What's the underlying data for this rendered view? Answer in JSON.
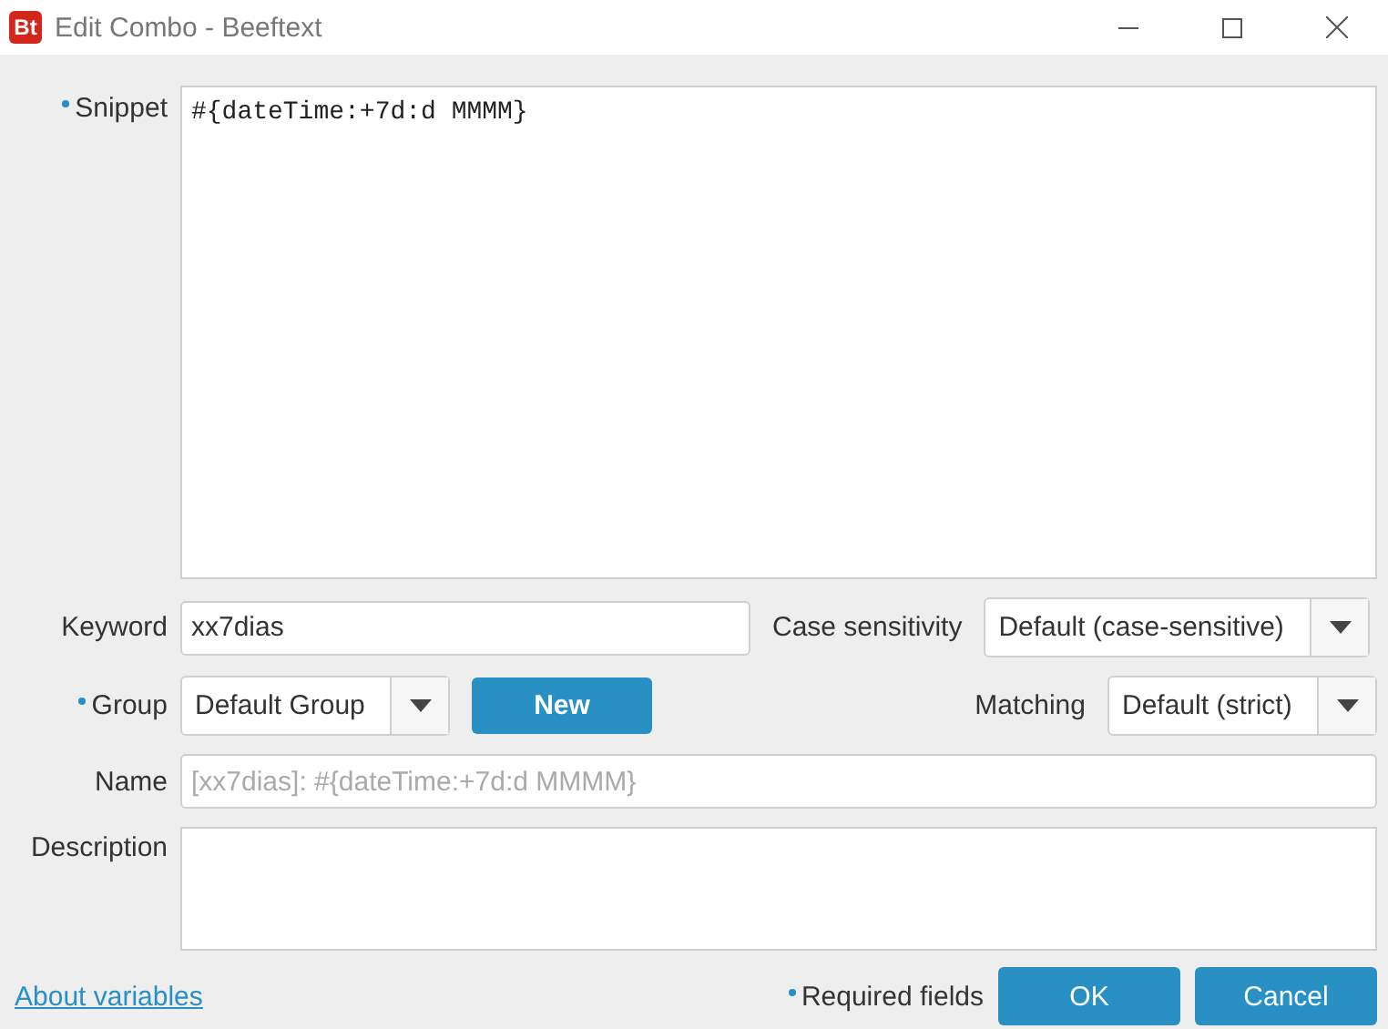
{
  "window": {
    "app_icon": "Bt",
    "title": "Edit Combo - Beeftext"
  },
  "snippet": {
    "label": "Snippet",
    "required": true,
    "value": "#{dateTime:+7d:d MMMM}"
  },
  "keyword": {
    "label": "Keyword",
    "required": false,
    "value": "xx7dias"
  },
  "case_sensitivity": {
    "label": "Case sensitivity",
    "value": "Default (case-sensitive)"
  },
  "group": {
    "label": "Group",
    "required": true,
    "value": "Default Group",
    "new_button": "New"
  },
  "matching": {
    "label": "Matching",
    "value": "Default (strict)"
  },
  "name": {
    "label": "Name",
    "required": false,
    "placeholder": "[xx7dias]: #{dateTime:+7d:d MMMM}"
  },
  "description": {
    "label": "Description",
    "required": false
  },
  "footer": {
    "link": "About variables",
    "required_note": "Required fields",
    "buttons": [
      "OK",
      "Cancel"
    ]
  }
}
